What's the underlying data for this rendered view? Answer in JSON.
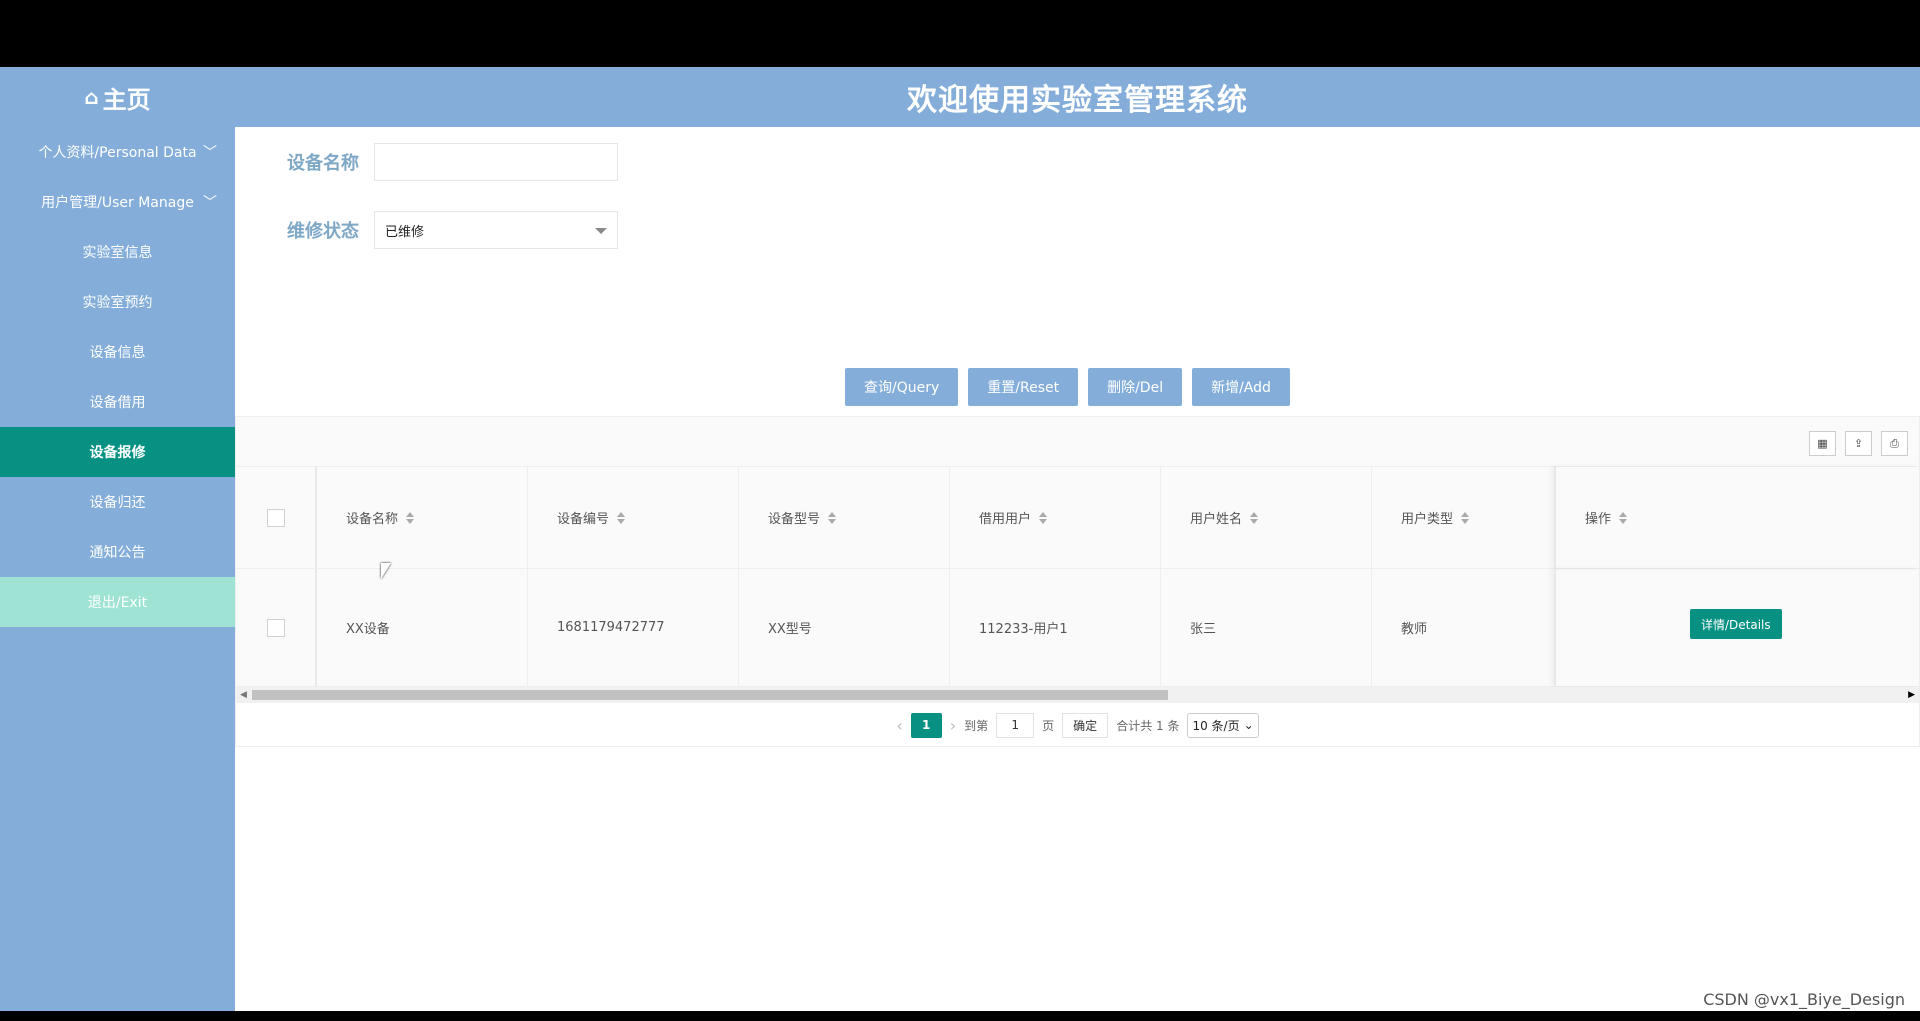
{
  "header": {
    "brand_icon": "home-icon",
    "brand_label": "主页",
    "title": "欢迎使用实验室管理系统"
  },
  "sidebar": {
    "items": [
      {
        "label": "个人资料/Personal Data",
        "has_chevron": true
      },
      {
        "label": "用户管理/User Manage",
        "has_chevron": true
      },
      {
        "label": "实验室信息"
      },
      {
        "label": "实验室预约"
      },
      {
        "label": "设备信息"
      },
      {
        "label": "设备借用"
      },
      {
        "label": "设备报修",
        "active": true
      },
      {
        "label": "设备归还"
      },
      {
        "label": "通知公告"
      },
      {
        "label": "退出/Exit"
      }
    ]
  },
  "search": {
    "name_label": "设备名称",
    "name_value": "",
    "status_label": "维修状态",
    "status_value": "已维修"
  },
  "buttons": {
    "query": "查询/Query",
    "reset": "重置/Reset",
    "delete": "删除/Del",
    "add": "新增/Add"
  },
  "table": {
    "columns": [
      "设备名称",
      "设备编号",
      "设备型号",
      "借用用户",
      "用户姓名",
      "用户类型",
      "操作"
    ],
    "rows": [
      [
        "XX设备",
        "1681179472777",
        "XX型号",
        "112233-用户1",
        "张三",
        "教师"
      ]
    ],
    "detail_label": "详情/Details"
  },
  "pager": {
    "current": "1",
    "goto_label": "到第",
    "goto_value": "1",
    "page_unit": "页",
    "confirm": "确定",
    "total": "合计共 1 条",
    "page_size": "10 条/页"
  },
  "watermark": "CSDN @vx1_Biye_Design",
  "colors": {
    "primary": "#84aed9",
    "accent": "#079183",
    "exit": "#9ee3d4"
  }
}
